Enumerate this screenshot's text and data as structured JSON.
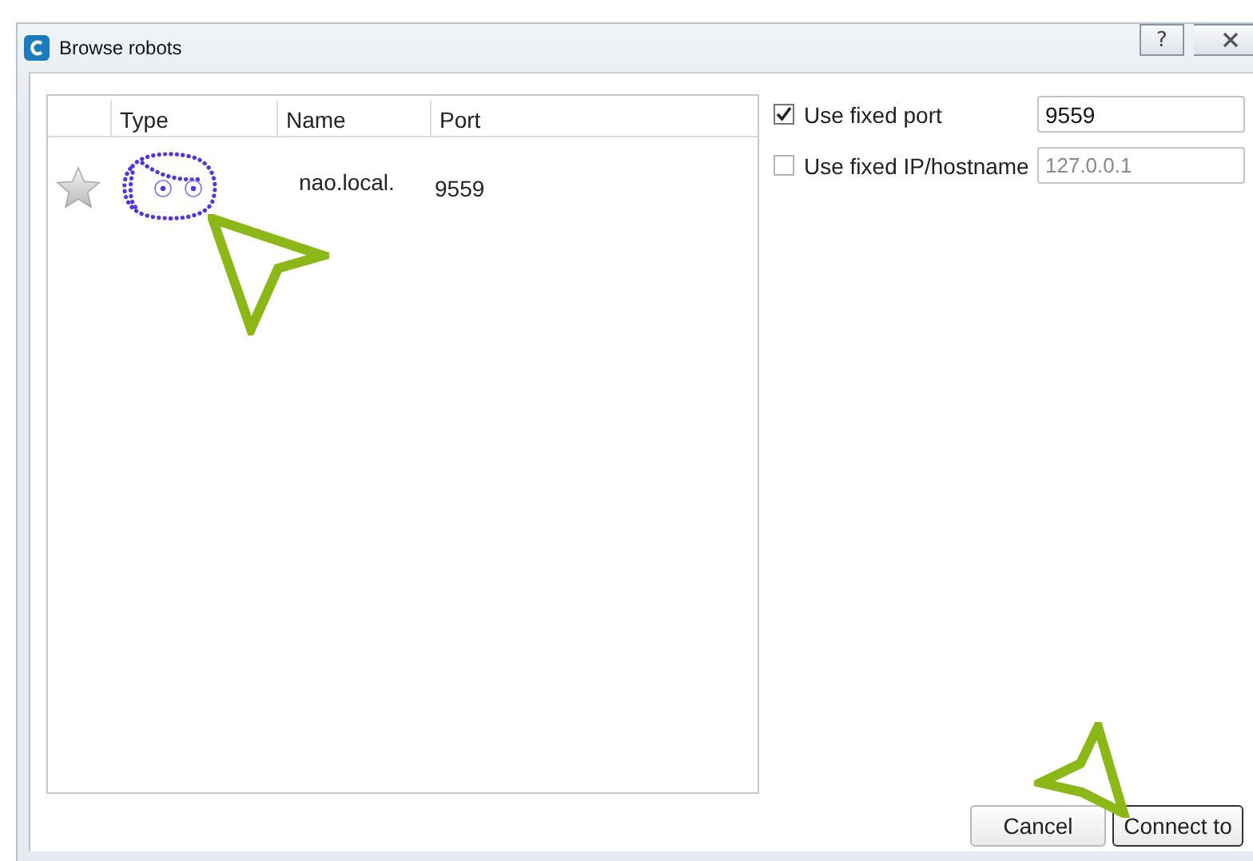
{
  "window": {
    "title": "Browse robots",
    "help_button": "?"
  },
  "table": {
    "columns": [
      "Type",
      "Name",
      "Port"
    ],
    "rows": [
      {
        "favorite": false,
        "name": "nao.local.",
        "port": "9559"
      }
    ]
  },
  "options": [
    {
      "label": "Use fixed port",
      "checked": true,
      "value": "9559",
      "disabled": false
    },
    {
      "label": "Use fixed IP/hostname",
      "checked": false,
      "value": "127.0.0.1",
      "disabled": true
    }
  ],
  "buttons": [
    {
      "label": "Cancel",
      "default": false
    },
    {
      "label": "Connect to",
      "default": true
    }
  ]
}
